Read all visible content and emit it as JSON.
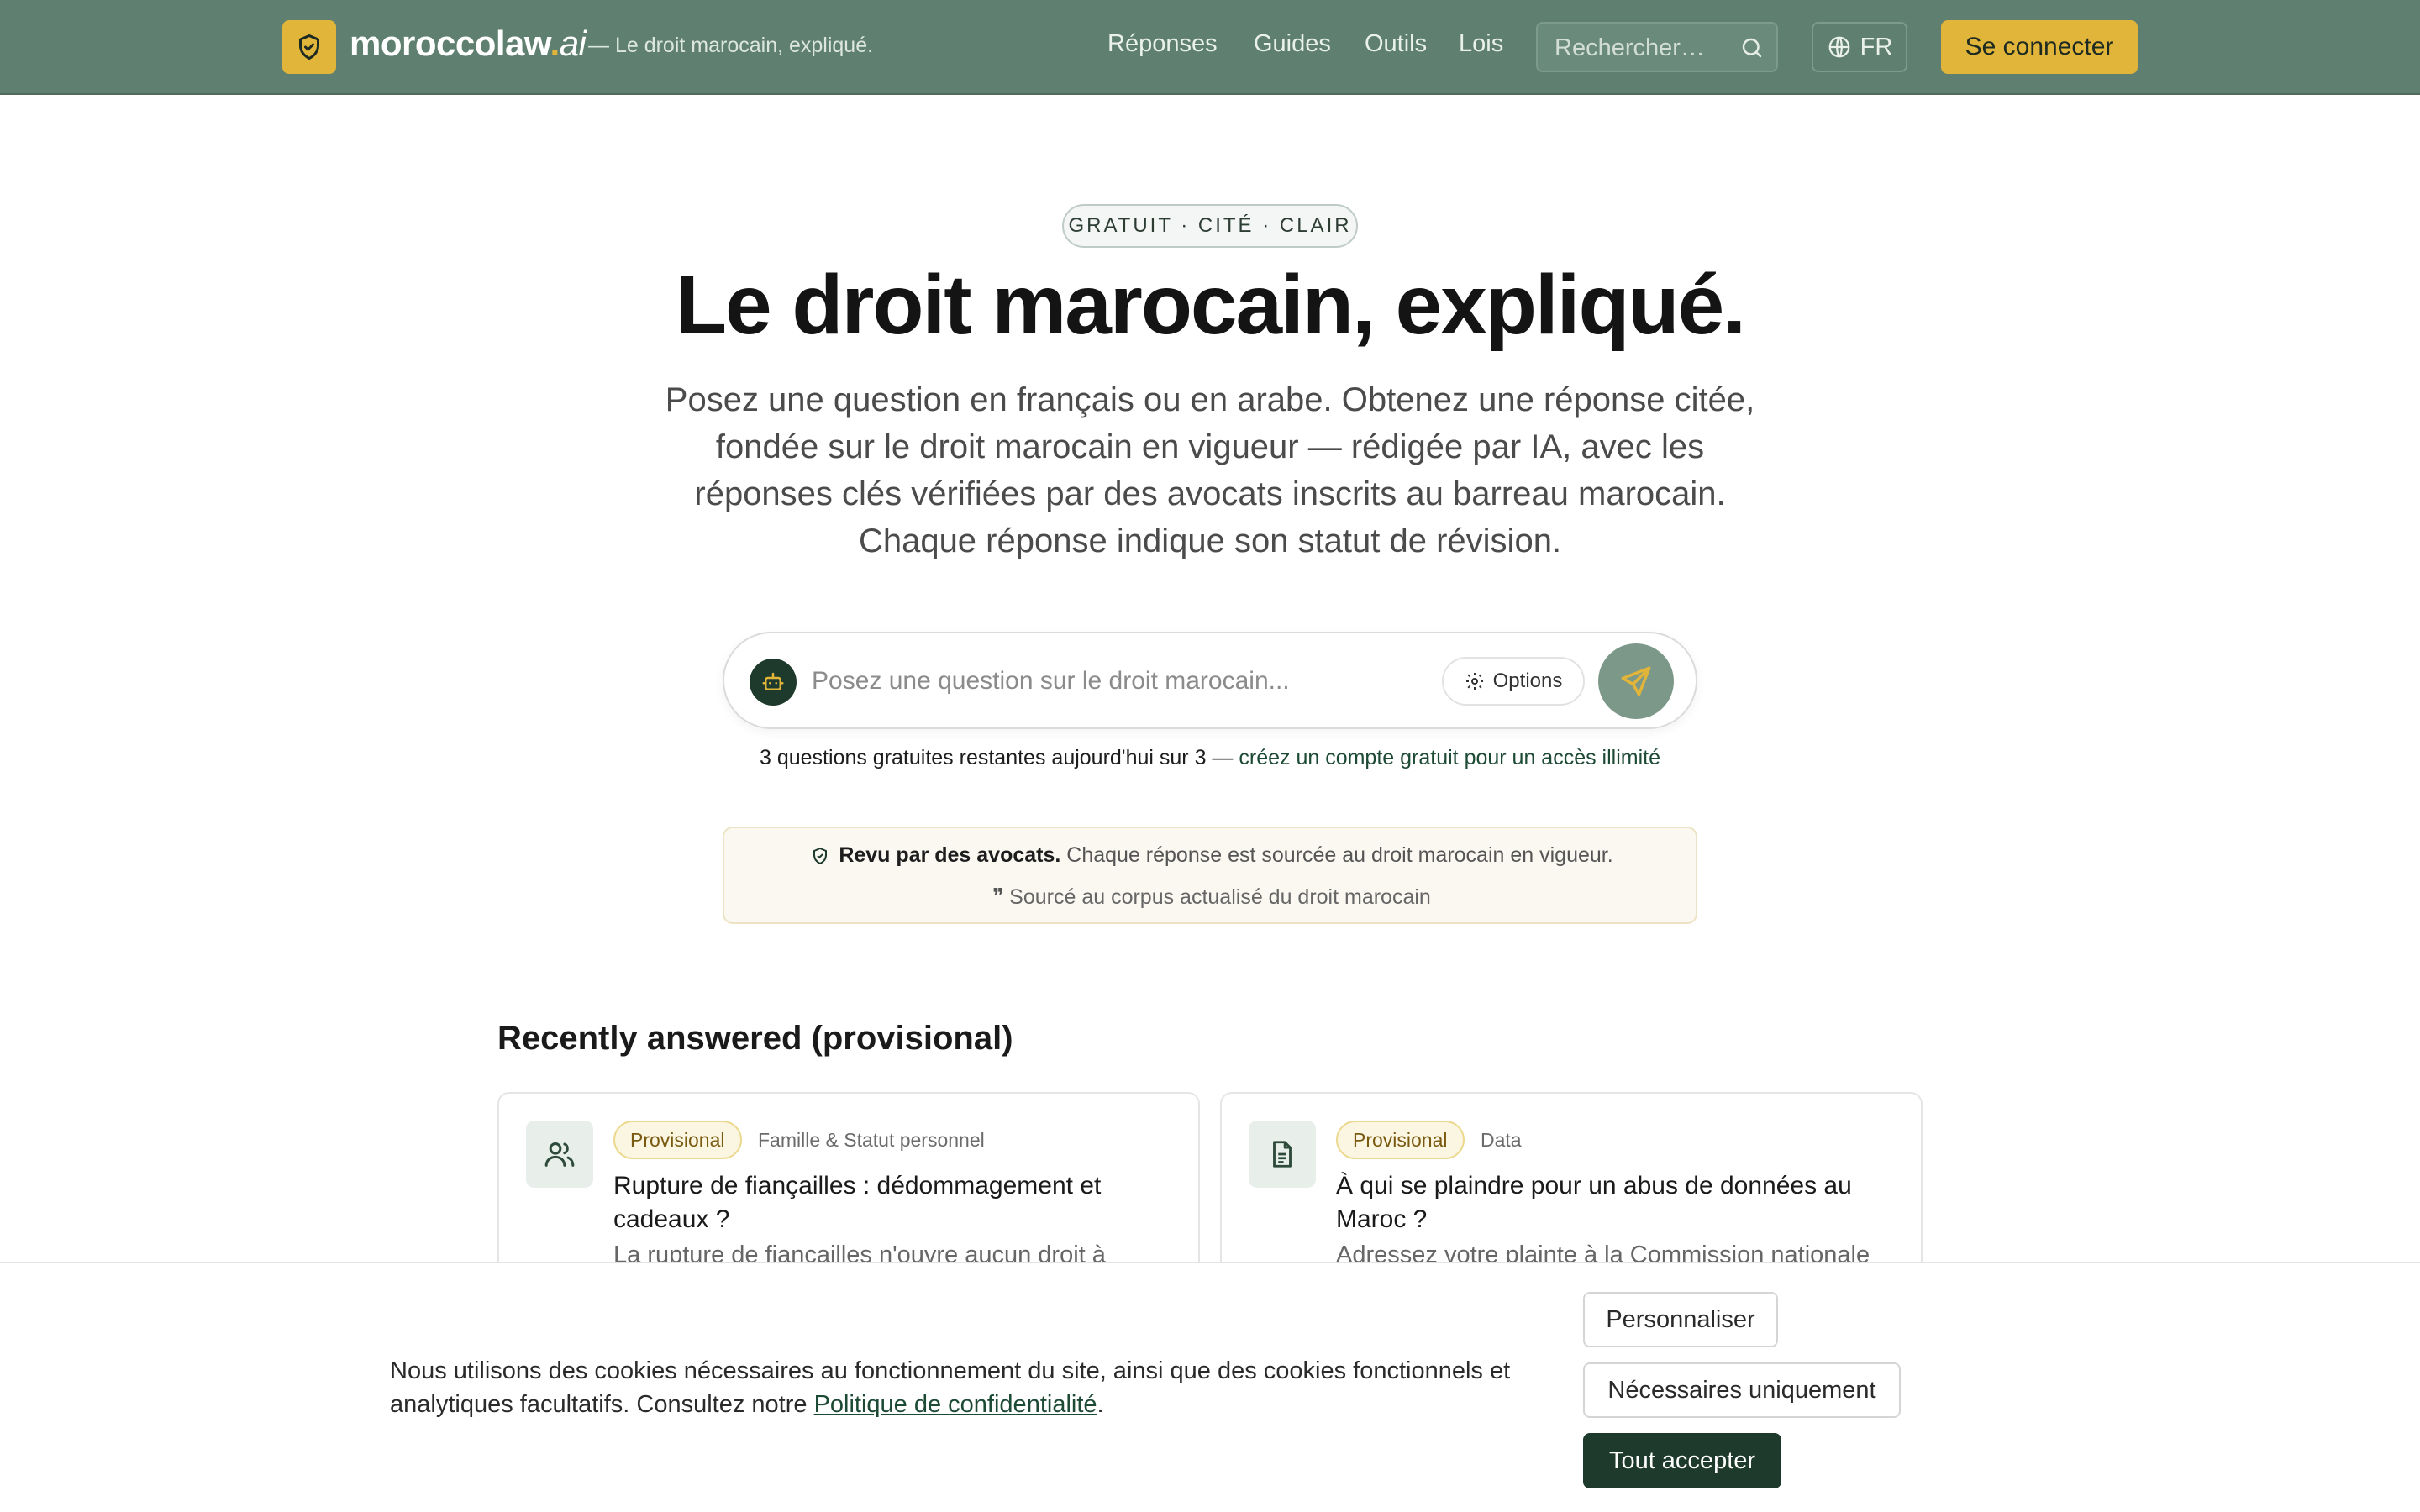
{
  "header": {
    "brand_name": "moroccolaw",
    "brand_dot": ".",
    "brand_tld": "ai",
    "tagline": "— Le droit marocain, expliqué.",
    "nav": [
      "Réponses",
      "Guides",
      "Outils",
      "Lois"
    ],
    "search_placeholder": "Rechercher…",
    "language": "FR",
    "login_label": "Se connecter"
  },
  "hero": {
    "pill": "GRATUIT · CITÉ · CLAIR",
    "title": "Le droit marocain, expliqué.",
    "subtitle": "Posez une question en français ou en arabe. Obtenez une réponse citée, fondée sur le droit marocain en vigueur — rédigée par IA, avec les réponses clés vérifiées par des avocats inscrits au barreau marocain. Chaque réponse indique son statut de révision."
  },
  "ask": {
    "placeholder": "Posez une question sur le droit marocain...",
    "options_label": "Options"
  },
  "quota": {
    "text": "3 questions gratuites restantes aujourd'hui sur 3",
    "separator": " — ",
    "link": "créez un compte gratuit pour un accès illimité"
  },
  "review": {
    "bold": "Revu par des avocats.",
    "text": "Chaque réponse est sourcée au droit marocain en vigueur.",
    "sourced": "Sourcé au corpus actualisé du droit marocain"
  },
  "recent": {
    "title": "Recently answered (provisional)",
    "cards": [
      {
        "badge": "Provisional",
        "category": "Famille & Statut personnel",
        "title": "Rupture de fiançailles : dédommagement et cadeaux ?",
        "excerpt": "La rupture de fiançailles n'ouvre aucun droit à",
        "icon": "users-icon"
      },
      {
        "badge": "Provisional",
        "category": "Data",
        "title": "À qui se plaindre pour un abus de données au Maroc ?",
        "excerpt": "Adressez votre plainte à la Commission nationale",
        "icon": "document-icon"
      }
    ]
  },
  "cookie": {
    "text": "Nous utilisons des cookies nécessaires au fonctionnement du site, ainsi que des cookies fonctionnels et analytiques facultatifs. Consultez notre",
    "policy_link": "Politique de confidentialité",
    "period": ".",
    "customize": "Personnaliser",
    "necessary": "Nécessaires uniquement",
    "accept_all": "Tout accepter"
  },
  "colors": {
    "header_bg": "#5f8070",
    "accent_gold": "#e1b43a",
    "dark_green": "#1d3a2c"
  }
}
